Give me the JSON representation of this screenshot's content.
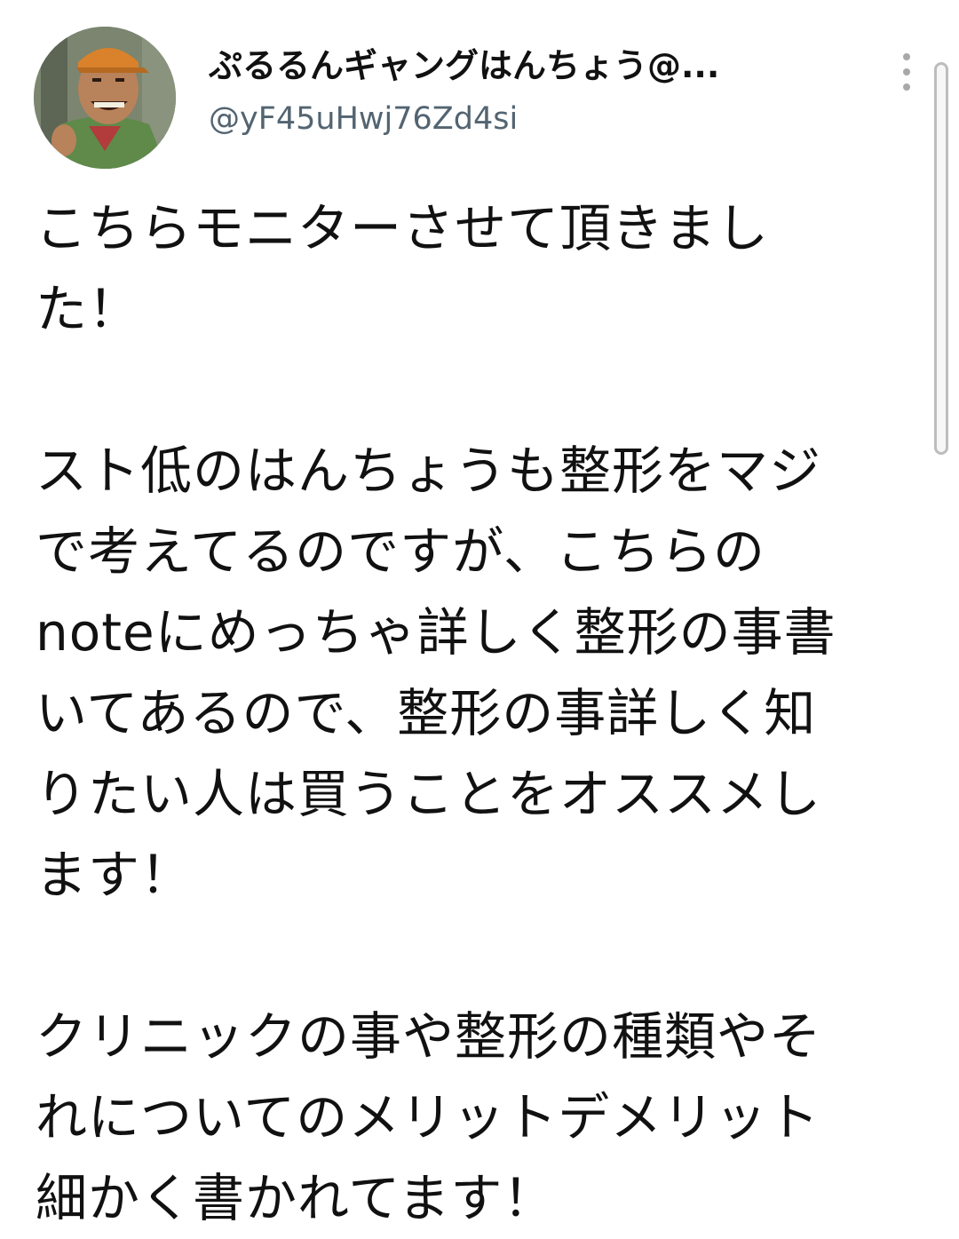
{
  "tweet": {
    "author": {
      "display_name": "ぷるるんギャングはんちょう@...",
      "handle": "@yF45uHwj76Zd4si",
      "avatar_icon": "cartoon-avatar-icon"
    },
    "more_icon": "more-vertical-icon",
    "body": "こちらモニターさせて頂きまし\nた！\n\nスト低のはんちょうも整形をマジ\nで考えてるのですが、こちらの\nnoteにめっちゃ詳しく整形の事書\nいてあるので、整形の事詳しく知\nりたい人は買うことをオススメし\nます！\n\nクリニックの事や整形の種類やそ\nれについてのメリットデメリット\n細かく書かれてます！"
  },
  "colors": {
    "text": "#111111",
    "handle": "#536471",
    "icon_gray": "#a8a8a8",
    "background": "#ffffff"
  }
}
